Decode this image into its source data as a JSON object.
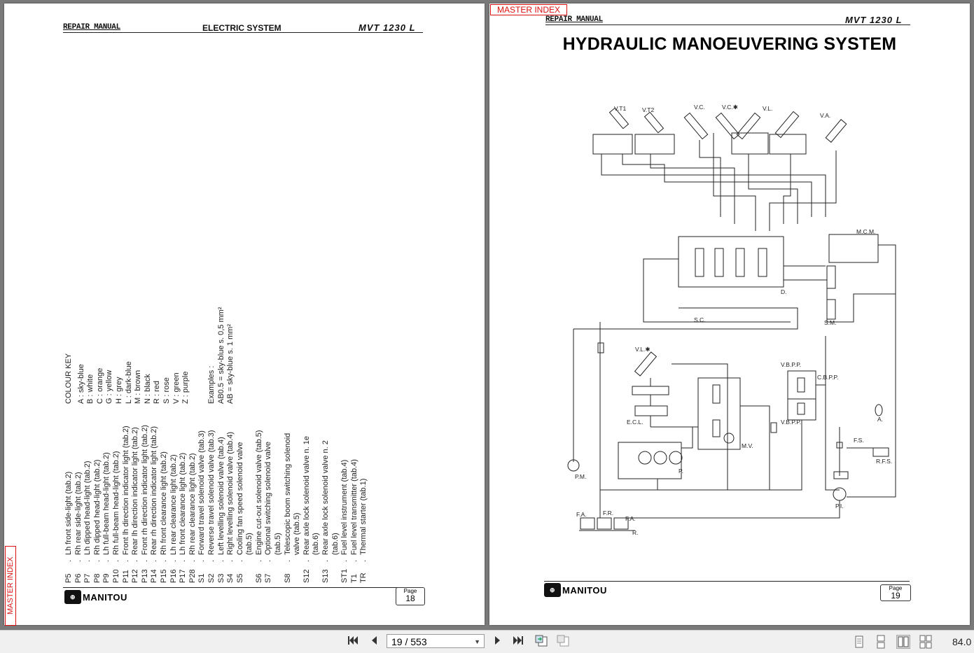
{
  "viewer": {
    "master_index_label": "MASTER INDEX",
    "page_field": "19 / 553",
    "zoom": "84.0"
  },
  "left_page": {
    "header": {
      "repair_manual": "REPAIR MANUAL",
      "section": "ELECTRIC SYSTEM",
      "model": "MVT 1230 L"
    },
    "items": [
      {
        "code": "P5",
        "text": "Lh front side-light (tab.2)"
      },
      {
        "code": "P6",
        "text": "Rh rear side-light (tab.2)"
      },
      {
        "code": "P7",
        "text": "Lh dipped head-light (tab.2)"
      },
      {
        "code": "P8",
        "text": "Rh dipped head-light (tab.2)"
      },
      {
        "code": "P9",
        "text": "Lh full-beam head-light (tab.2)"
      },
      {
        "code": "P10",
        "text": "Rh full-beam head-light (tab.2)"
      },
      {
        "code": "P11",
        "text": "Front lh direction indicator light (tab.2)"
      },
      {
        "code": "P12",
        "text": "Rear lh direction indicator light (tab.2)"
      },
      {
        "code": "P13",
        "text": "Front rh direction indicator light (tab.2)"
      },
      {
        "code": "P14",
        "text": "Rear rh direction indicator light (tab.2)"
      },
      {
        "code": "P15",
        "text": "Rh front clearance light (tab.2)"
      },
      {
        "code": "P16",
        "text": "Lh rear clearance light (tab.2)"
      },
      {
        "code": "P17",
        "text": "Lh front clearance light (tab.2)"
      },
      {
        "code": "P28",
        "text": "Rh rear clearance light (tab.2)"
      },
      {
        "code": "S1",
        "text": "Forward travel solenoid valve (tab.3)"
      },
      {
        "code": "S2",
        "text": "Reverse travel solenoid valve (tab.3)"
      },
      {
        "code": "S3",
        "text": "Left levelling solenoid valve (tab.4)"
      },
      {
        "code": "S4",
        "text": "Right levelling solenoid valve (tab.4)"
      },
      {
        "code": "S5",
        "text": "Cooling fan speed solenoid valve"
      },
      {
        "code": "",
        "text": "(tab.5)"
      },
      {
        "code": "S6",
        "text": "Engine cut-out solenoid valve (tab.5)"
      },
      {
        "code": "S7",
        "text": "Optional switching solenoid valve"
      },
      {
        "code": "",
        "text": "(tab.5)"
      },
      {
        "code": "S8",
        "text": "Telescopic boom switching solenoid"
      },
      {
        "code": "",
        "text": "valve (tab.5)"
      },
      {
        "code": "S12",
        "text": "Rear axle lock solenoid valve n. 1e"
      },
      {
        "code": "",
        "text": "(tab.6)"
      },
      {
        "code": "S13",
        "text": "Rear axle lock solenoid valve n. 2"
      },
      {
        "code": "",
        "text": "(tab.6)"
      },
      {
        "code": "ST1",
        "text": "Fuel level instrument (tab.4)"
      },
      {
        "code": "T1",
        "text": "Fuel level transmitter (tab.4)"
      },
      {
        "code": "TR",
        "text": "Thermal starter (tab.1)"
      }
    ],
    "colour_key_title": "COLOUR KEY",
    "colours": [
      "A : sky-blue",
      "B : white",
      "C : orange",
      "G : yellow",
      "H : grey",
      "L : dark-blue",
      "M : brown",
      "N : black",
      "R : red",
      "S : rose",
      "V : green",
      "Z : purple"
    ],
    "examples_title": "Examples :",
    "examples": [
      "AB0.5 = sky-blue s. 0,5 mm²",
      "AB = sky-blue s. 1 mm²"
    ],
    "logo": "MANITOU",
    "page_label": "Page",
    "page_number": "18"
  },
  "right_page": {
    "header": {
      "repair_manual": "REPAIR MANUAL",
      "model": "MVT 1230 L"
    },
    "title": "HYDRAULIC MANOEUVERING SYSTEM",
    "diagram_labels": {
      "vt1": "V.T1",
      "vt2": "V.T2",
      "vc": "V.C.",
      "vcs": "V.C.✱",
      "vl": "V.L.",
      "va": "V.A.",
      "mcm": "M.C.M.",
      "d": "D.",
      "sc": "S.C.",
      "sm": "S.M.",
      "vls": "V.L.✱",
      "ecl": "E.C.L.",
      "mv": "M.V.",
      "vbpp1": "V.B.P.P.",
      "cbpp": "C.B.P.P.",
      "vbpp2": "V.B.P.P.",
      "a": "A.",
      "fs": "F.S.",
      "rfs": "R.F.S.",
      "pm": "P.M.",
      "p": "P.",
      "pi": "P.I.",
      "fa1": "F.A.",
      "fr": "F.R.",
      "fa2": "F.A.",
      "r": "R."
    },
    "logo": "MANITOU",
    "page_label": "Page",
    "page_number": "19"
  }
}
